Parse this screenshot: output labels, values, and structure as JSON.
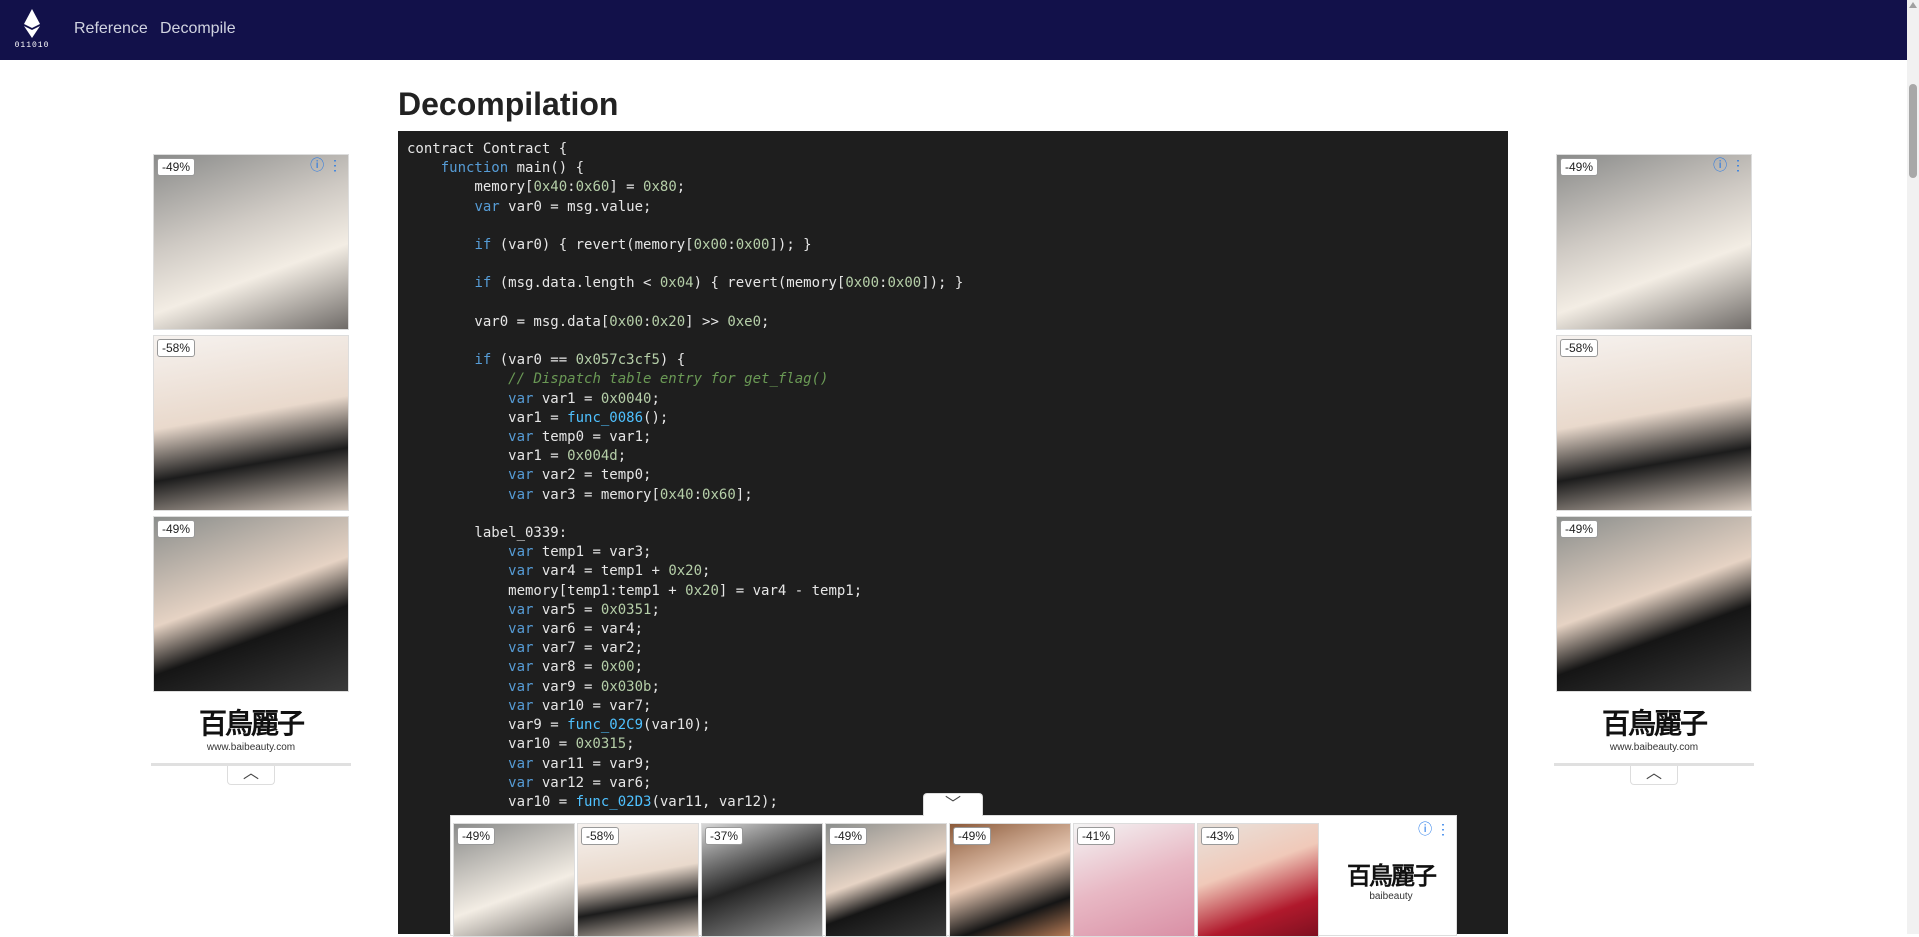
{
  "nav": {
    "logo_text": "011010",
    "links": [
      "Reference",
      "Decompile"
    ]
  },
  "page": {
    "title": "Decompilation"
  },
  "side_ads": {
    "badges": [
      "-49%",
      "-58%",
      "-49%"
    ],
    "brand_name": "百鳥麗子",
    "brand_url": "www.baibeauty.com"
  },
  "bottom_ad": {
    "badges": [
      "-49%",
      "-58%",
      "-37%",
      "-49%",
      "-49%",
      "-41%",
      "-43%"
    ],
    "brand_name": "百鳥麗子",
    "brand_caption": "baibeauty"
  },
  "code": {
    "lines": [
      "contract Contract {",
      "    function main() {",
      "        memory[0x40:0x60] = 0x80;",
      "        var var0 = msg.value;",
      "",
      "        if (var0) { revert(memory[0x00:0x00]); }",
      "",
      "        if (msg.data.length < 0x04) { revert(memory[0x00:0x00]); }",
      "",
      "        var0 = msg.data[0x00:0x20] >> 0xe0;",
      "",
      "        if (var0 == 0x057c3cf5) {",
      "            // Dispatch table entry for get_flag()",
      "            var var1 = 0x0040;",
      "            var1 = func_0086();",
      "            var temp0 = var1;",
      "            var1 = 0x004d;",
      "            var var2 = temp0;",
      "            var var3 = memory[0x40:0x60];",
      "",
      "        label_0339:",
      "            var temp1 = var3;",
      "            var var4 = temp1 + 0x20;",
      "            memory[temp1:temp1 + 0x20] = var4 - temp1;",
      "            var var5 = 0x0351;",
      "            var var6 = var4;",
      "            var var7 = var2;",
      "            var var8 = 0x00;",
      "            var var9 = 0x030b;",
      "            var var10 = var7;",
      "            var9 = func_02C9(var10);",
      "            var10 = 0x0315;",
      "            var var11 = var9;",
      "            var var12 = var6;",
      "            var10 = func_02D3(var11, var12);"
    ]
  },
  "colors": {
    "nav_bg": "#12114a",
    "code_bg": "#1e1e1e",
    "keyword": "#569cd6",
    "number": "#b5cea8",
    "function": "#4fc1ff",
    "comment": "#6a9955"
  }
}
